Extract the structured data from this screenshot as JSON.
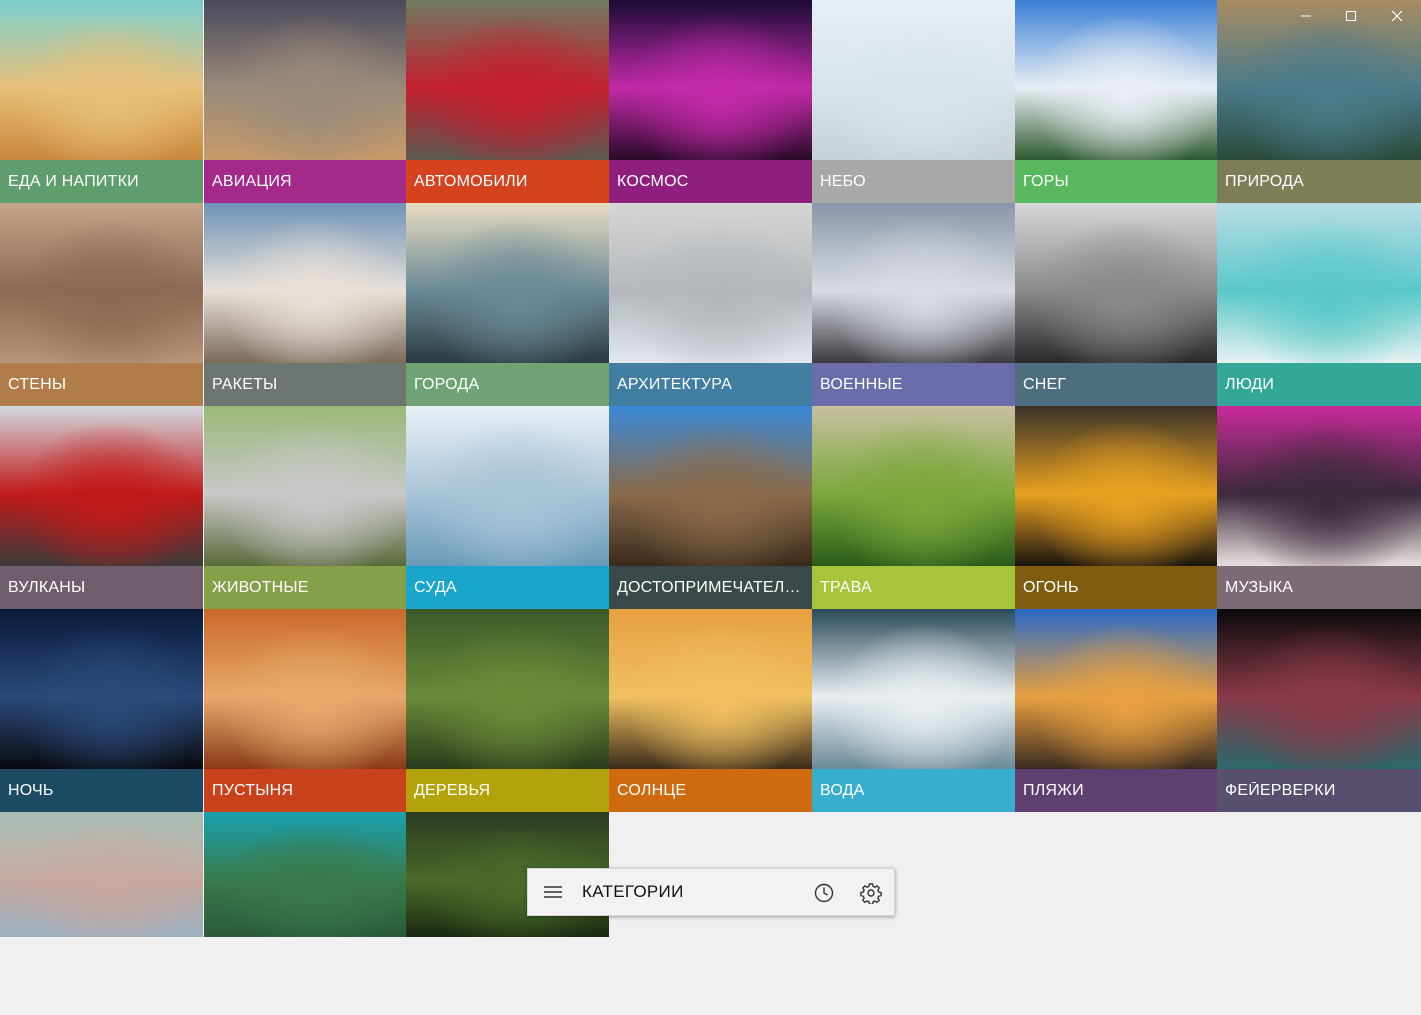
{
  "window": {
    "minimize_icon": "minimize-icon",
    "maximize_icon": "maximize-icon",
    "close_icon": "close-icon"
  },
  "categories": [
    {
      "label": "ЕДА И НАПИТКИ",
      "color": "#5f9e6c",
      "photo": [
        "#7ccfcf",
        "#e8c07a",
        "#c8883c"
      ]
    },
    {
      "label": "АВИАЦИЯ",
      "color": "#a32a8a",
      "photo": [
        "#4a4a5c",
        "#9a8a7a",
        "#c89a6a"
      ]
    },
    {
      "label": "АВТОМОБИЛИ",
      "color": "#d4421e",
      "photo": [
        "#6f7a5f",
        "#c42030",
        "#5a5a50"
      ]
    },
    {
      "label": "КОСМОС",
      "color": "#8e1f7d",
      "photo": [
        "#1a0b35",
        "#c22aa8",
        "#2a0a2a"
      ]
    },
    {
      "label": "НЕБО",
      "color": "#a8a8a8",
      "photo": [
        "#e6eef2",
        "#d8e4ea",
        "#c6d2d8"
      ]
    },
    {
      "label": "ГОРЫ",
      "color": "#58b85f",
      "photo": [
        "#3b7fd6",
        "#e8eef4",
        "#2d5a2f"
      ]
    },
    {
      "label": "ПРИРОДА",
      "color": "#7d7d57",
      "photo": [
        "#a88c62",
        "#4a7a8a",
        "#2a4a3a"
      ]
    },
    {
      "label": "СТЕНЫ",
      "color": "#b07c4a",
      "photo": [
        "#c4a48a",
        "#8a6a52",
        "#b89478"
      ]
    },
    {
      "label": "РАКЕТЫ",
      "color": "#6d7670",
      "photo": [
        "#6f93b8",
        "#e8e0d8",
        "#7a6a5a"
      ]
    },
    {
      "label": "ГОРОДА",
      "color": "#6fa373",
      "photo": [
        "#e8dcc0",
        "#6a8a96",
        "#2a3a40"
      ]
    },
    {
      "label": "АРХИТЕКТУРА",
      "color": "#417ea1",
      "photo": [
        "#d6d6d6",
        "#b4b8bc",
        "#e2e8ee"
      ]
    },
    {
      "label": "ВОЕННЫЕ",
      "color": "#6b6dab",
      "photo": [
        "#8a96a8",
        "#d8dce2",
        "#3a3a40"
      ]
    },
    {
      "label": "СНЕГ",
      "color": "#4d6d80",
      "photo": [
        "#d8d8d8",
        "#8a8a8a",
        "#2a2a2a"
      ]
    },
    {
      "label": "ЛЮДИ",
      "color": "#33a898",
      "photo": [
        "#b8dce8",
        "#5ac8c8",
        "#e8f2f2"
      ]
    },
    {
      "label": "ВУЛКАНЫ",
      "color": "#6e5e6c",
      "photo": [
        "#d2dae0",
        "#c21a1a",
        "#3a3a3a"
      ]
    },
    {
      "label": "ЖИВОТНЫЕ",
      "color": "#86a04a",
      "photo": [
        "#9ab878",
        "#c8c8c8",
        "#5a6a3a"
      ]
    },
    {
      "label": "СУДА",
      "color": "#1aa6cc",
      "photo": [
        "#e8f0f6",
        "#a8c4d8",
        "#6a9ab8"
      ]
    },
    {
      "label": "ДОСТОПРИМЕЧАТЕЛЬНОСТИ",
      "color": "#3a4a48",
      "photo": [
        "#3a8ad8",
        "#8a6a4a",
        "#3a2a1a"
      ]
    },
    {
      "label": "ТРАВА",
      "color": "#a8c43a",
      "photo": [
        "#c8c0a0",
        "#7aa83a",
        "#2a5a1a"
      ]
    },
    {
      "label": "ОГОНЬ",
      "color": "#7f5c10",
      "photo": [
        "#3a3228",
        "#e8a020",
        "#1a1410"
      ]
    },
    {
      "label": "МУЗЫКА",
      "color": "#7c6a76",
      "photo": [
        "#c82a9a",
        "#3a2a3a",
        "#e8e0e0"
      ]
    },
    {
      "label": "НОЧЬ",
      "color": "#1d4b63",
      "photo": [
        "#0a1a3a",
        "#2a4a7a",
        "#0a0a10"
      ]
    },
    {
      "label": "ПУСТЫНЯ",
      "color": "#c9421c",
      "photo": [
        "#c86a2a",
        "#e8a86a",
        "#8a3a1a"
      ]
    },
    {
      "label": "ДЕРЕВЬЯ",
      "color": "#b3a30a",
      "photo": [
        "#3a5a2a",
        "#6a8a3a",
        "#2a3a1a"
      ]
    },
    {
      "label": "СОЛНЦЕ",
      "color": "#d06a10",
      "photo": [
        "#e8a040",
        "#f0c060",
        "#3a2a1a"
      ]
    },
    {
      "label": "ВОДА",
      "color": "#37aecd",
      "photo": [
        "#2a4a5a",
        "#e8eef0",
        "#6a8a9a"
      ]
    },
    {
      "label": "ПЛЯЖИ",
      "color": "#5f3f70",
      "photo": [
        "#2a6ac8",
        "#e8a040",
        "#3a2a20"
      ]
    },
    {
      "label": "ФЕЙЕРВЕРКИ",
      "color": "#584f70",
      "photo": [
        "#0a0a0a",
        "#8a3a4a",
        "#2a6a6a"
      ]
    },
    {
      "label": "",
      "color": "",
      "photo": [
        "#a8c0b8",
        "#c8a8a0",
        "#9ab0c0"
      ]
    },
    {
      "label": "",
      "color": "",
      "photo": [
        "#1aa0b0",
        "#3a7a4a",
        "#2a5a3a"
      ]
    },
    {
      "label": "",
      "color": "",
      "photo": [
        "#2a3a20",
        "#4a6a2a",
        "#1a2a10"
      ]
    }
  ],
  "command_bar": {
    "title": "КАТЕГОРИИ",
    "menu_icon": "hamburger-menu-icon",
    "history_icon": "clock-icon",
    "settings_icon": "gear-icon"
  }
}
